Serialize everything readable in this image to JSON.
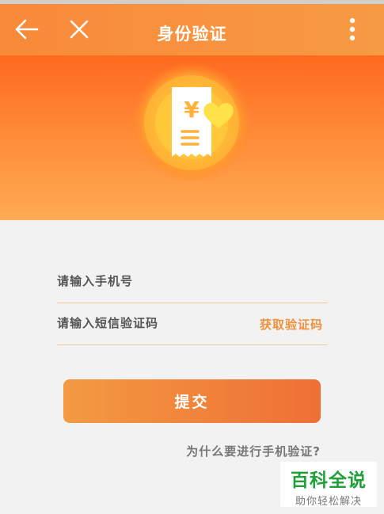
{
  "header": {
    "title": "身份验证",
    "back_icon": "back-arrow-icon",
    "close_icon": "close-icon",
    "more_icon": "more-vertical-icon",
    "background_color": "#f8903f"
  },
  "hero": {
    "illustration_icon": "receipt-yuan-heart-icon",
    "receipt_symbol": "¥",
    "gradient_colors": [
      "#ff6a1f",
      "#ffab52"
    ]
  },
  "form": {
    "phone_placeholder": "请输入手机号",
    "phone_value": "",
    "sms_code_placeholder": "请输入短信验证码",
    "sms_code_value": "",
    "get_code_label": "获取验证码",
    "submit_label": "提交",
    "accent_color": "#f0923d"
  },
  "footer": {
    "why_verify_link": "为什么要进行手机验证?"
  },
  "watermark": {
    "main": "百科全说",
    "sub": "助你轻松解决"
  }
}
